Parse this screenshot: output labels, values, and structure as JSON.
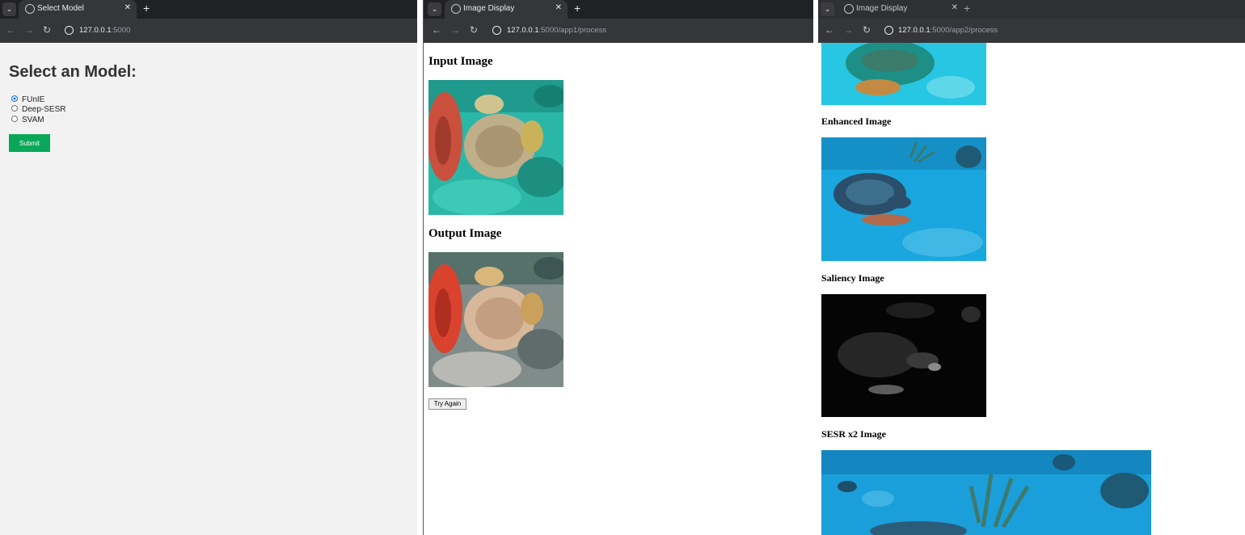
{
  "windows": [
    {
      "tab_title": "Select Model",
      "url_host": "127.0.0.1",
      "url_rest": ":5000",
      "heading": "Select an Model:",
      "options": [
        {
          "label": "FUnIE",
          "checked": true
        },
        {
          "label": "Deep-SESR",
          "checked": false
        },
        {
          "label": "SVAM",
          "checked": false
        }
      ],
      "submit_label": "Submit"
    },
    {
      "tab_title": "Image Display",
      "url_host": "127.0.0.1",
      "url_rest": ":5000/app1/process",
      "input_heading": "Input Image",
      "output_heading": "Output Image",
      "try_again_label": "Try Again"
    },
    {
      "tab_title": "Image Display",
      "url_host": "127.0.0.1",
      "url_rest": ":5000/app2/process",
      "enhanced_heading": "Enhanced Image",
      "saliency_heading": "Saliency Image",
      "sesr_heading": "SESR x2 Image"
    }
  ],
  "icons": {
    "tab_dropdown": "chevron-down-icon",
    "close": "close-icon",
    "new_tab": "plus-icon",
    "back": "back-arrow-icon",
    "forward": "forward-arrow-icon",
    "reload": "reload-icon",
    "site_info": "info-icon"
  },
  "colors": {
    "chrome_dark": "#202124",
    "chrome_tab": "#35363a",
    "submit_green": "#0aa75a",
    "page_gray": "#f2f2f2"
  },
  "glyphs": {
    "chevron": "⌄",
    "close": "✕",
    "plus": "+",
    "back": "←",
    "forward": "→",
    "reload": "↻"
  }
}
